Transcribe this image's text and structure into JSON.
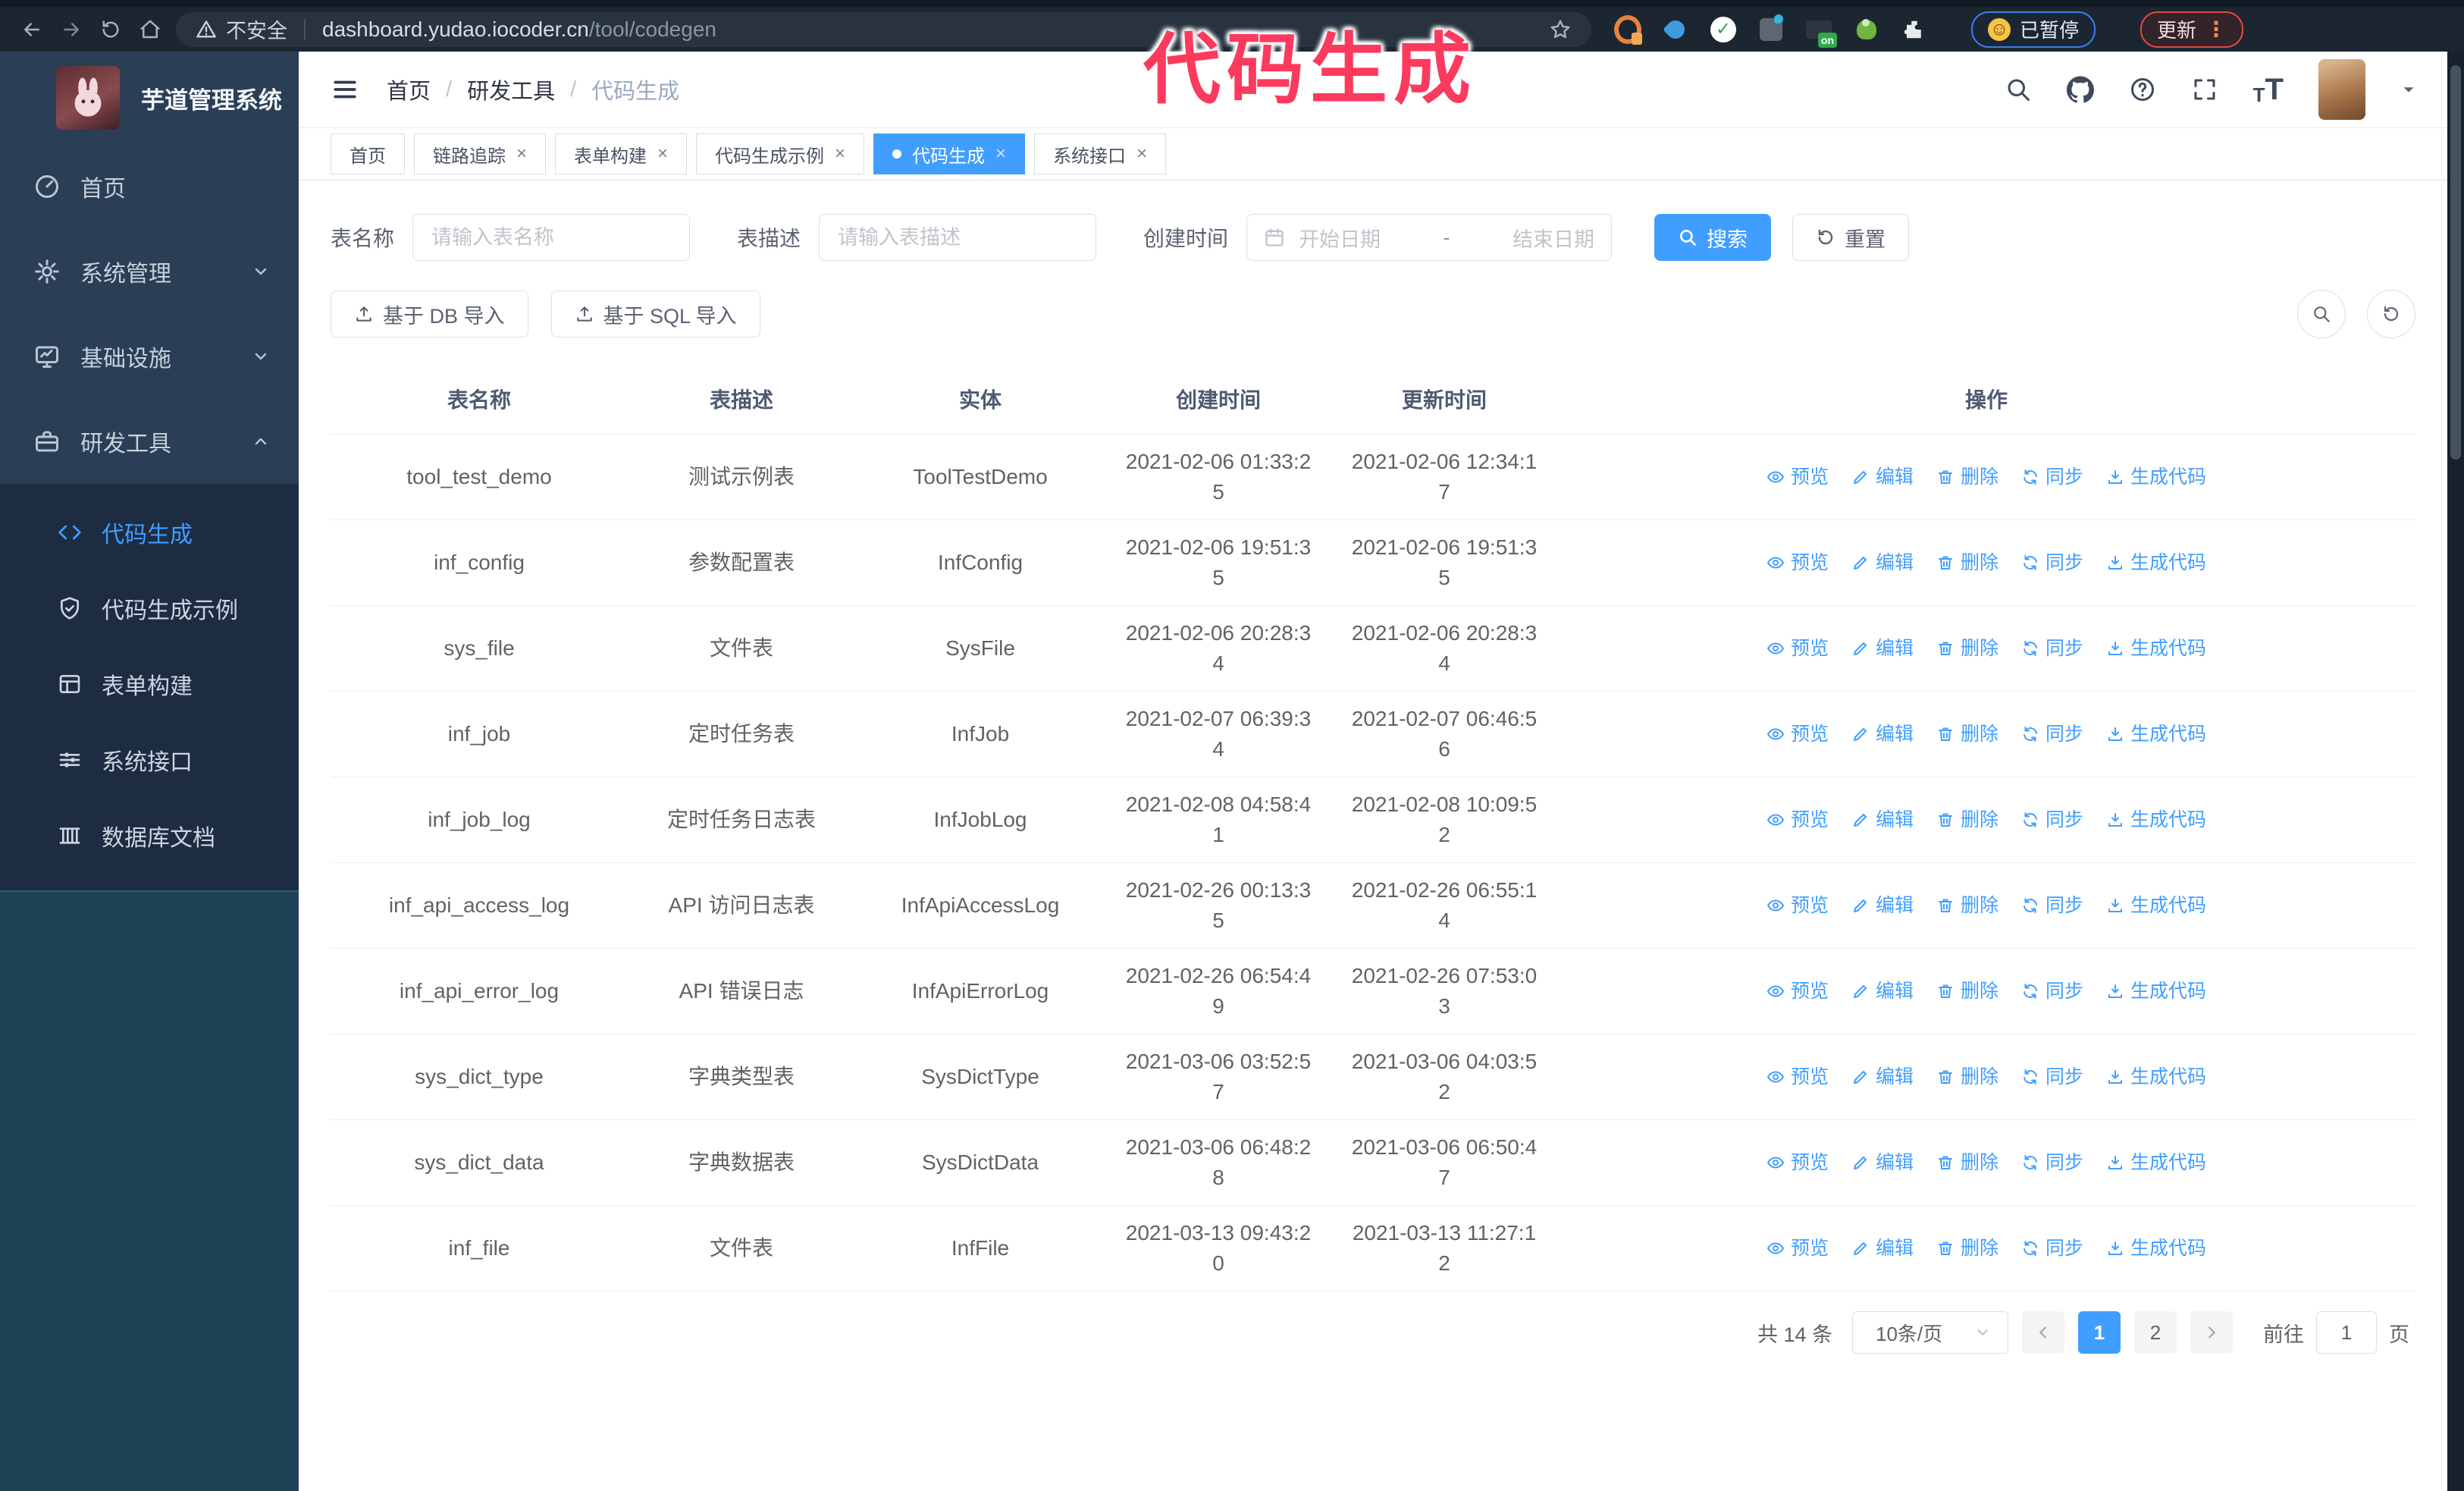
{
  "colors": {
    "accent": "#409eff",
    "annotation_pink": "#fb3a5e",
    "sidebar_bg": "#1f4156",
    "submenu_bg": "#1e2c42",
    "chrome_bg": "#1c2631"
  },
  "icons": {
    "close": "×",
    "smiley": "☺",
    "dots": "⋮",
    "ext_on_label": "on",
    "ext_check": "✓"
  },
  "annotation": {
    "text": "代码生成"
  },
  "browser": {
    "security_label": "不安全",
    "url_host": "dashboard.yudao.iocoder.cn",
    "url_path": "/tool/codegen",
    "paused_badge": "已暂停",
    "update_badge": "更新"
  },
  "sidebar": {
    "logo_title": "芋道管理系统",
    "items": [
      {
        "label": "首页"
      },
      {
        "label": "系统管理"
      },
      {
        "label": "基础设施"
      },
      {
        "label": "研发工具"
      }
    ],
    "submenu": [
      {
        "label": "代码生成"
      },
      {
        "label": "代码生成示例"
      },
      {
        "label": "表单构建"
      },
      {
        "label": "系统接口"
      },
      {
        "label": "数据库文档"
      }
    ]
  },
  "header": {
    "breadcrumb": [
      "首页",
      "研发工具",
      "代码生成"
    ],
    "separator": "/"
  },
  "tabs": [
    {
      "label": "首页"
    },
    {
      "label": "链路追踪"
    },
    {
      "label": "表单构建"
    },
    {
      "label": "代码生成示例"
    },
    {
      "label": "代码生成"
    },
    {
      "label": "系统接口"
    }
  ],
  "filters": {
    "name_label": "表名称",
    "name_placeholder": "请输入表名称",
    "desc_label": "表描述",
    "desc_placeholder": "请输入表描述",
    "time_label": "创建时间",
    "start_placeholder": "开始日期",
    "range_separator": "-",
    "end_placeholder": "结束日期",
    "search_label": "搜索",
    "reset_label": "重置"
  },
  "toolbar": {
    "import_db_label": "基于 DB 导入",
    "import_sql_label": "基于 SQL 导入"
  },
  "table": {
    "columns": [
      "表名称",
      "表描述",
      "实体",
      "创建时间",
      "更新时间",
      "操作"
    ],
    "actions": [
      "预览",
      "编辑",
      "删除",
      "同步",
      "生成代码"
    ],
    "rows": [
      [
        "tool_test_demo",
        "测试示例表",
        "ToolTestDemo",
        "2021-02-06 01:33:25",
        "2021-02-06 12:34:17"
      ],
      [
        "inf_config",
        "参数配置表",
        "InfConfig",
        "2021-02-06 19:51:35",
        "2021-02-06 19:51:35"
      ],
      [
        "sys_file",
        "文件表",
        "SysFile",
        "2021-02-06 20:28:34",
        "2021-02-06 20:28:34"
      ],
      [
        "inf_job",
        "定时任务表",
        "InfJob",
        "2021-02-07 06:39:34",
        "2021-02-07 06:46:56"
      ],
      [
        "inf_job_log",
        "定时任务日志表",
        "InfJobLog",
        "2021-02-08 04:58:41",
        "2021-02-08 10:09:52"
      ],
      [
        "inf_api_access_log",
        "API 访问日志表",
        "InfApiAccessLog",
        "2021-02-26 00:13:35",
        "2021-02-26 06:55:14"
      ],
      [
        "inf_api_error_log",
        "API 错误日志",
        "InfApiErrorLog",
        "2021-02-26 06:54:49",
        "2021-02-26 07:53:03"
      ],
      [
        "sys_dict_type",
        "字典类型表",
        "SysDictType",
        "2021-03-06 03:52:57",
        "2021-03-06 04:03:52"
      ],
      [
        "sys_dict_data",
        "字典数据表",
        "SysDictData",
        "2021-03-06 06:48:28",
        "2021-03-06 06:50:47"
      ],
      [
        "inf_file",
        "文件表",
        "InfFile",
        "2021-03-13 09:43:20",
        "2021-03-13 11:27:12"
      ]
    ]
  },
  "pagination": {
    "total": "共 14 条",
    "page_size": "10条/页",
    "pages": [
      "1",
      "2"
    ],
    "goto_label": "前往",
    "goto_value": "1",
    "page_suffix": "页"
  }
}
